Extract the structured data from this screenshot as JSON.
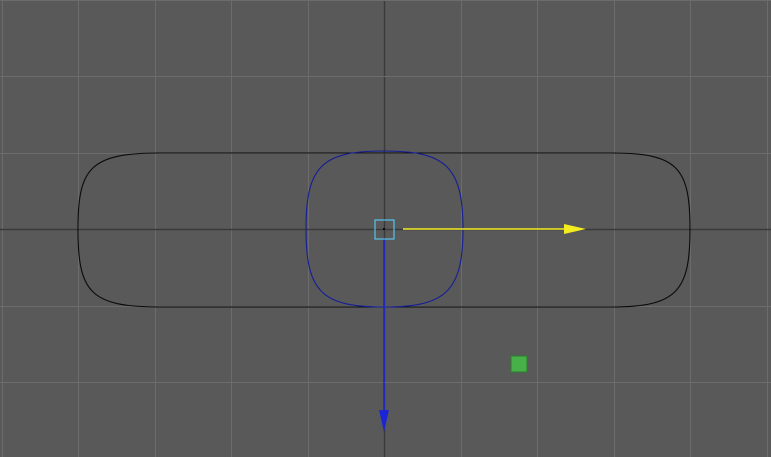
{
  "viewport": {
    "view": "top",
    "colors": {
      "background": "#595959",
      "grid_line": "#6c6c6c",
      "grid_axis": "#3a3a3a",
      "outer_curve": "#0a0a0a",
      "inner_curve": "#141e96",
      "translate_x_arrow": "#f2ec21",
      "translate_z_arrow": "#1c25d6",
      "pivot_handle": "#55c4ee",
      "plane_handle": "#48b048"
    },
    "objects": [
      {
        "name": "outer-rounded-curve",
        "shape": "rounded-rectangle",
        "selected": false
      },
      {
        "name": "inner-rounded-curve",
        "shape": "rounded-square",
        "selected": true
      }
    ],
    "manipulator": {
      "tool": "move",
      "handles": [
        "center-pivot-handle",
        "x-axis-arrow",
        "z-axis-arrow",
        "plane-handle"
      ]
    }
  }
}
